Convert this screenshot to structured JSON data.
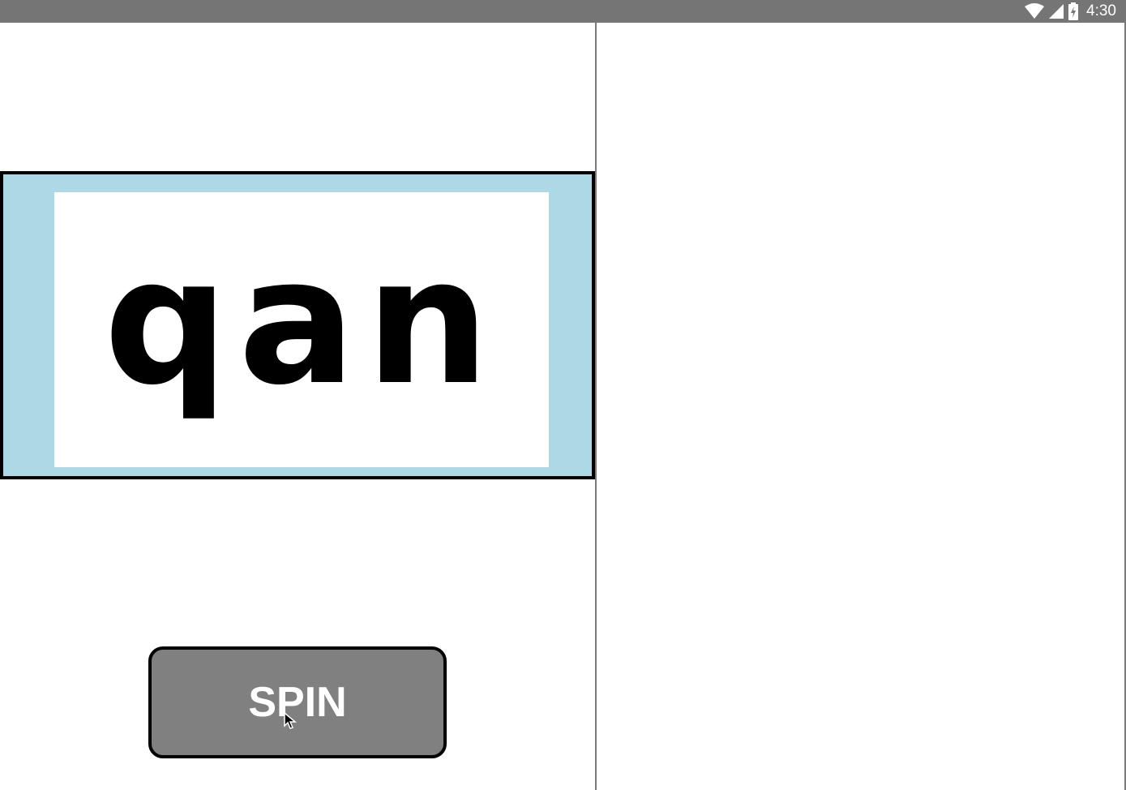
{
  "status_bar": {
    "time": "4:30",
    "icons": [
      "wifi-icon",
      "cellular-signal-icon",
      "battery-charging-icon"
    ]
  },
  "game": {
    "word": "qan",
    "spin_label": "SPIN"
  },
  "colors": {
    "status_bar": "#757575",
    "frame_background": "#add8e6",
    "button_background": "#808080",
    "button_text": "#ffffff"
  }
}
